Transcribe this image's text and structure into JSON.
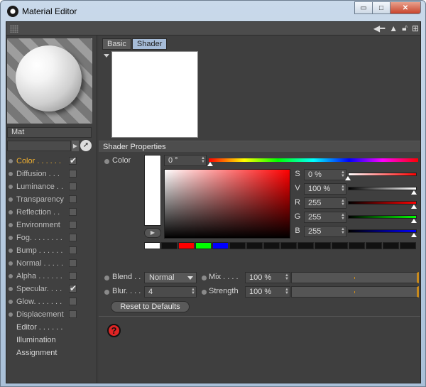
{
  "window": {
    "title": "Material Editor",
    "buttons": {
      "minimize": "▭",
      "maximize": "□",
      "close": "✕"
    }
  },
  "toolbar": {
    "icons": [
      "back-arrow-icon",
      "pointer-icon",
      "lock-icon",
      "new-window-icon"
    ]
  },
  "material": {
    "name": "Mat"
  },
  "channels": [
    {
      "label": "Color",
      "dots": "Color . . . . . .",
      "checked": true,
      "active": true
    },
    {
      "label": "Diffusion",
      "dots": "Diffusion . . .",
      "checked": false
    },
    {
      "label": "Luminance",
      "dots": "Luminance . .",
      "checked": false
    },
    {
      "label": "Transparency",
      "dots": "Transparency",
      "checked": false
    },
    {
      "label": "Reflection",
      "dots": "Reflection . .",
      "checked": false
    },
    {
      "label": "Environment",
      "dots": "Environment",
      "checked": false
    },
    {
      "label": "Fog",
      "dots": "Fog. . . . . . . .",
      "checked": false
    },
    {
      "label": "Bump",
      "dots": "Bump . . . . . .",
      "checked": false
    },
    {
      "label": "Normal",
      "dots": "Normal . . . . .",
      "checked": false
    },
    {
      "label": "Alpha",
      "dots": "Alpha . . . . . .",
      "checked": false
    },
    {
      "label": "Specular",
      "dots": "Specular. . . .",
      "checked": true
    },
    {
      "label": "Glow",
      "dots": "Glow. . . . . . .",
      "checked": false
    },
    {
      "label": "Displacement",
      "dots": "Displacement",
      "checked": false
    }
  ],
  "extra_items": [
    "Editor . . . . . .",
    "Illumination",
    "Assignment"
  ],
  "tabs": [
    "Basic",
    "Shader"
  ],
  "active_tab": "Shader",
  "shader": {
    "heading": "Shader Properties",
    "color_label": "Color",
    "hue": "0 °",
    "s": {
      "label": "S",
      "value": "0 %",
      "level": 0
    },
    "v": {
      "label": "V",
      "value": "100 %",
      "level": 1
    },
    "r": {
      "label": "R",
      "value": "255",
      "level": 1
    },
    "g": {
      "label": "G",
      "value": "255",
      "level": 1
    },
    "b": {
      "label": "B",
      "value": "255",
      "level": 1
    },
    "presets": [
      "#ffffff",
      "#111111",
      "#ff0000",
      "#00ff00",
      "#0000ff",
      "#111111",
      "#111111",
      "#111111",
      "#111111",
      "#111111",
      "#111111",
      "#111111",
      "#111111",
      "#111111",
      "#111111",
      "#111111"
    ],
    "blend_label": "Blend . .",
    "blend_value": "Normal",
    "mix_label": "Mix . . . .",
    "mix_value": "100 %",
    "blur_label": "Blur. . . .",
    "blur_value": "4",
    "strength_label": "Strength",
    "strength_value": "100 %",
    "reset_label": "Reset to Defaults"
  },
  "help": "?",
  "colors": {
    "accent": "#f0b030",
    "tab_active": "#a6bcd8",
    "panel": "#3f3f3f"
  }
}
